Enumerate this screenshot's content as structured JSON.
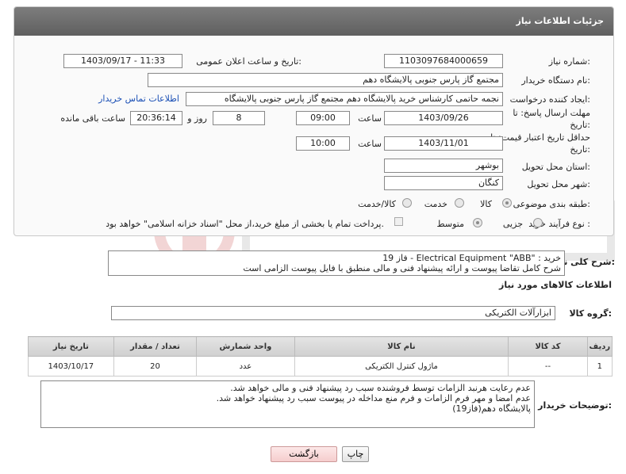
{
  "header": {
    "title": "جزئیات اطلاعات نیاز"
  },
  "fields": {
    "need_number_label": "شماره نیاز:",
    "need_number": "1103097684000659",
    "announce_label": "تاریخ و ساعت اعلان عمومی:",
    "announce_value": "1403/09/17 - 11:33",
    "buyer_org_label": "نام دستگاه خریدار:",
    "buyer_org": "مجتمع گاز پارس جنوبی  پالایشگاه دهم",
    "creator_label": "ایجاد کننده درخواست:",
    "creator": "نجمه حاتمی کارشناس خرید پالایشگاه دهم  مجتمع گاز پارس جنوبی  پالایشگاه",
    "contact_link": "اطلاعات تماس خریدار",
    "deadline_label_1": "مهلت ارسال پاسخ: تا",
    "deadline_label_2": "تاریخ:",
    "deadline_date": "1403/09/26",
    "time_label": "ساعت",
    "deadline_time": "09:00",
    "days_value": "8",
    "days_label": "روز و",
    "remaining_time": "20:36:14",
    "remaining_label": "ساعت باقی مانده",
    "validity_label_1": "حداقل تاریخ اعتبار قیمت: تا",
    "validity_label_2": "تاریخ:",
    "validity_date": "1403/11/01",
    "validity_time": "10:00",
    "province_label": "استان محل تحویل:",
    "province": "بوشهر",
    "city_label": "شهر محل تحویل:",
    "city": "کنگان",
    "category_label": "طبقه بندی موضوعی:",
    "category_options": [
      "کالا",
      "خدمت",
      "کالا/خدمت"
    ],
    "process_label": "نوع فرآیند خرید :",
    "process_options": [
      "جزیی",
      "متوسط"
    ],
    "payment_note": "پرداخت تمام یا بخشی از مبلغ خرید،از محل \"اسناد خزانه اسلامی\" خواهد بود."
  },
  "summary": {
    "label": "شرح کلی نیاز:",
    "line1": "خرید : \"Electrical Equipment \"ABB - فاز 19",
    "line2": "شرح کامل تقاضا پیوست و ارائه پیشنهاد فنی و مالی منطبق با فایل پیوست الزامی است"
  },
  "goods_section": {
    "title": "اطلاعات کالاهای مورد نیاز",
    "group_label": "گروه کالا:",
    "group_value": "ابزارآلات الکتریکی"
  },
  "table": {
    "headers": [
      "ردیف",
      "کد کالا",
      "نام کالا",
      "واحد شمارش",
      "تعداد / مقدار",
      "تاریخ نیاز"
    ],
    "rows": [
      [
        "1",
        "--",
        "ماژول کنترل الکتریکی",
        "عدد",
        "20",
        "1403/10/17"
      ]
    ]
  },
  "buyer_notes": {
    "label": "توضیحات خریدار:",
    "line1": "عدم رعایت هرنبد الزامات توسط فروشنده سبب رد پیشنهاد فنی و مالی خواهد شد.",
    "line2": "عدم امضا و مهر فرم الزامات و فرم منع مداخله در پیوست سبب رد پیشنهاد خواهد شد.",
    "line3": "پالایشگاه دهم(فاز19)"
  },
  "buttons": {
    "print": "چاپ",
    "back": "بازگشت"
  },
  "colors": {
    "header_bg": "#6d6d6d",
    "link": "#1a4fb5",
    "back_btn": "#f5cdcd"
  }
}
